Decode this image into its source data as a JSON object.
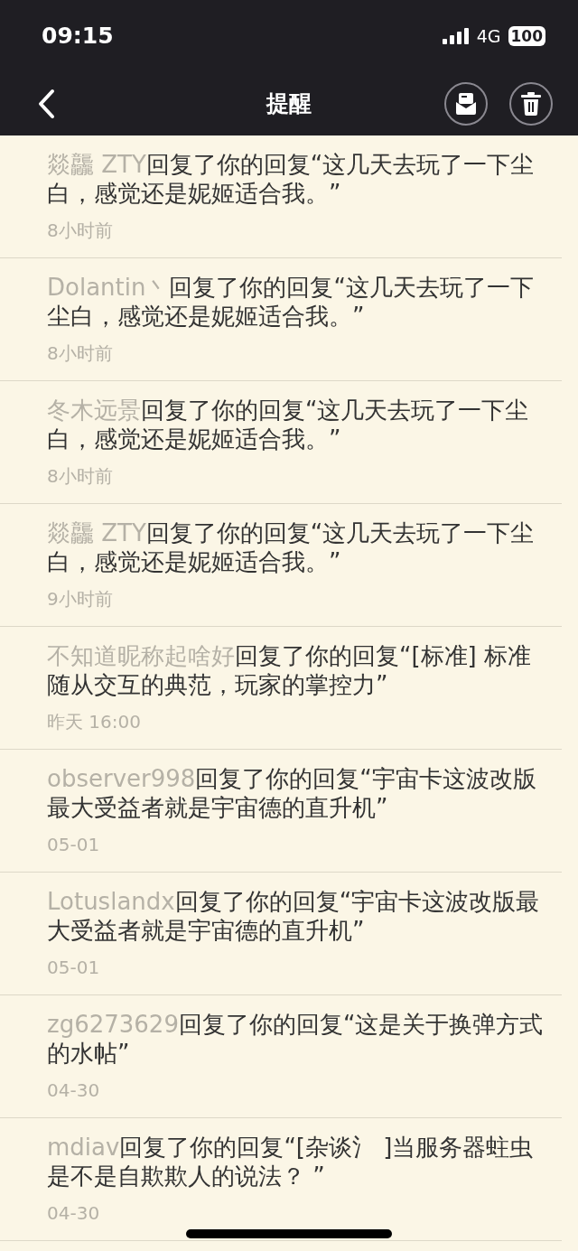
{
  "status_bar": {
    "time": "09:15",
    "network": "4G",
    "battery": "100"
  },
  "header": {
    "title": "提醒"
  },
  "notifications": [
    {
      "user": "燚龘 ZTY",
      "text": "回复了你的回复“这几天去玩了一下尘白，感觉还是妮姬适合我。”",
      "time": "8小时前"
    },
    {
      "user": "Dolantin丶",
      "text": "回复了你的回复“这几天去玩了一下尘白，感觉还是妮姬适合我。”",
      "time": "8小时前"
    },
    {
      "user": "冬木远景",
      "text": "回复了你的回复“这几天去玩了一下尘白，感觉还是妮姬适合我。”",
      "time": "8小时前"
    },
    {
      "user": "燚龘 ZTY",
      "text": "回复了你的回复“这几天去玩了一下尘白，感觉还是妮姬适合我。”",
      "time": "9小时前"
    },
    {
      "user": "不知道昵称起啥好",
      "text": "回复了你的回复“[标准] 标准随从交互的典范，玩家的掌控力”",
      "time": "昨天 16:00"
    },
    {
      "user": "observer998",
      "text": "回复了你的回复“宇宙卡这波改版最大受益者就是宇宙德的直升机”",
      "time": "05-01"
    },
    {
      "user": "Lotuslandx",
      "text": "回复了你的回复“宇宙卡这波改版最大受益者就是宇宙德的直升机”",
      "time": "05-01"
    },
    {
      "user": "zg6273629",
      "text": "回复了你的回复“这是关于换弹方式的水帖”",
      "time": "04-30"
    },
    {
      "user": "mdiav",
      "text": "回复了你的回复“[杂谈氵 ]当服务器蛀虫是不是自欺欺人的说法？ ”",
      "time": "04-30"
    }
  ]
}
